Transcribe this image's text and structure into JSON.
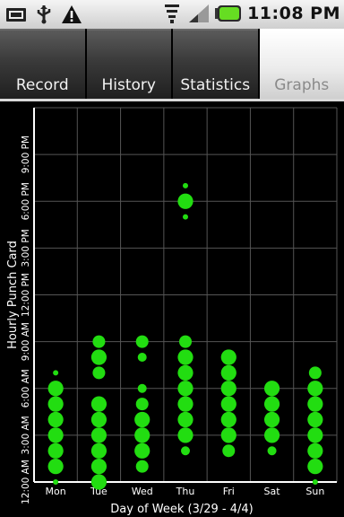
{
  "status_bar": {
    "time": "11:08 PM",
    "left_icons": [
      "sd-card-icon",
      "usb-icon",
      "warning-icon"
    ],
    "right_icons": [
      "wifi-icon",
      "signal-icon",
      "battery-icon"
    ],
    "battery_color": "#66dd22"
  },
  "tabs": [
    {
      "label": "Record",
      "active": false
    },
    {
      "label": "History",
      "active": false
    },
    {
      "label": "Statistics",
      "active": false
    },
    {
      "label": "Graphs",
      "active": true
    }
  ],
  "chart_data": {
    "type": "scatter",
    "xlabel": "Day of Week (3/29 - 4/4)",
    "ylabel": "Hourly Punch Card",
    "categories": [
      "Mon",
      "Tue",
      "Wed",
      "Thu",
      "Fri",
      "Sat",
      "Sun"
    ],
    "y_ticks": [
      "12:00 AM",
      "3:00 AM",
      "6:00 AM",
      "9:00 AM",
      "12:00 PM",
      "3:00 PM",
      "6:00 PM",
      "9:00 PM"
    ],
    "ylim": [
      0,
      24
    ],
    "grid": true,
    "marker_color": "#22dd11",
    "points": [
      {
        "day": "Mon",
        "hour": 0,
        "size": 1
      },
      {
        "day": "Mon",
        "hour": 1,
        "size": 4
      },
      {
        "day": "Mon",
        "hour": 2,
        "size": 4
      },
      {
        "day": "Mon",
        "hour": 3,
        "size": 4
      },
      {
        "day": "Mon",
        "hour": 4,
        "size": 4
      },
      {
        "day": "Mon",
        "hour": 5,
        "size": 4
      },
      {
        "day": "Mon",
        "hour": 6,
        "size": 4
      },
      {
        "day": "Mon",
        "hour": 7,
        "size": 1
      },
      {
        "day": "Tue",
        "hour": 0,
        "size": 4
      },
      {
        "day": "Tue",
        "hour": 1,
        "size": 4
      },
      {
        "day": "Tue",
        "hour": 2,
        "size": 4
      },
      {
        "day": "Tue",
        "hour": 3,
        "size": 4
      },
      {
        "day": "Tue",
        "hour": 4,
        "size": 4
      },
      {
        "day": "Tue",
        "hour": 5,
        "size": 4
      },
      {
        "day": "Tue",
        "hour": 7,
        "size": 3
      },
      {
        "day": "Tue",
        "hour": 8,
        "size": 4
      },
      {
        "day": "Tue",
        "hour": 9,
        "size": 3
      },
      {
        "day": "Wed",
        "hour": 1,
        "size": 3
      },
      {
        "day": "Wed",
        "hour": 2,
        "size": 4
      },
      {
        "day": "Wed",
        "hour": 3,
        "size": 4
      },
      {
        "day": "Wed",
        "hour": 4,
        "size": 4
      },
      {
        "day": "Wed",
        "hour": 5,
        "size": 3
      },
      {
        "day": "Wed",
        "hour": 6,
        "size": 2
      },
      {
        "day": "Wed",
        "hour": 8,
        "size": 2
      },
      {
        "day": "Wed",
        "hour": 9,
        "size": 3
      },
      {
        "day": "Thu",
        "hour": 2,
        "size": 2
      },
      {
        "day": "Thu",
        "hour": 3,
        "size": 4
      },
      {
        "day": "Thu",
        "hour": 4,
        "size": 4
      },
      {
        "day": "Thu",
        "hour": 5,
        "size": 4
      },
      {
        "day": "Thu",
        "hour": 6,
        "size": 4
      },
      {
        "day": "Thu",
        "hour": 7,
        "size": 4
      },
      {
        "day": "Thu",
        "hour": 8,
        "size": 4
      },
      {
        "day": "Thu",
        "hour": 9,
        "size": 3
      },
      {
        "day": "Thu",
        "hour": 17,
        "size": 1
      },
      {
        "day": "Thu",
        "hour": 18,
        "size": 4
      },
      {
        "day": "Thu",
        "hour": 19,
        "size": 1
      },
      {
        "day": "Fri",
        "hour": 2,
        "size": 3
      },
      {
        "day": "Fri",
        "hour": 3,
        "size": 4
      },
      {
        "day": "Fri",
        "hour": 4,
        "size": 4
      },
      {
        "day": "Fri",
        "hour": 5,
        "size": 4
      },
      {
        "day": "Fri",
        "hour": 6,
        "size": 4
      },
      {
        "day": "Fri",
        "hour": 7,
        "size": 4
      },
      {
        "day": "Fri",
        "hour": 8,
        "size": 4
      },
      {
        "day": "Sat",
        "hour": 2,
        "size": 2
      },
      {
        "day": "Sat",
        "hour": 3,
        "size": 4
      },
      {
        "day": "Sat",
        "hour": 4,
        "size": 4
      },
      {
        "day": "Sat",
        "hour": 5,
        "size": 4
      },
      {
        "day": "Sat",
        "hour": 6,
        "size": 4
      },
      {
        "day": "Sun",
        "hour": 0,
        "size": 1
      },
      {
        "day": "Sun",
        "hour": 1,
        "size": 4
      },
      {
        "day": "Sun",
        "hour": 2,
        "size": 4
      },
      {
        "day": "Sun",
        "hour": 3,
        "size": 4
      },
      {
        "day": "Sun",
        "hour": 4,
        "size": 4
      },
      {
        "day": "Sun",
        "hour": 5,
        "size": 4
      },
      {
        "day": "Sun",
        "hour": 6,
        "size": 4
      },
      {
        "day": "Sun",
        "hour": 7,
        "size": 3
      }
    ]
  }
}
